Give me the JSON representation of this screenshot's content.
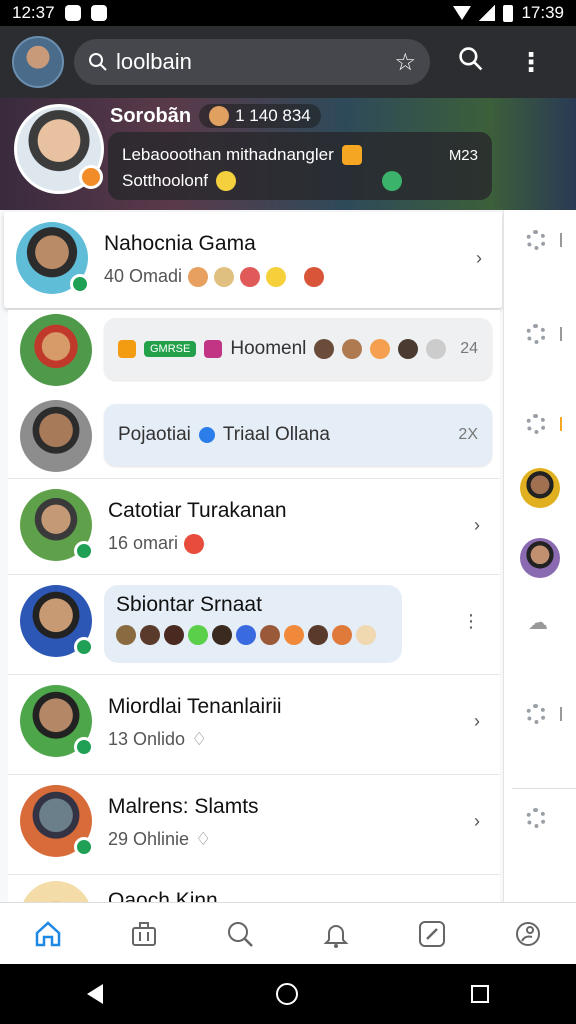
{
  "status_bar": {
    "time_left": "12:37",
    "time_right": "17:39"
  },
  "search": {
    "value": "loolbain"
  },
  "banner": {
    "name": "Sorobãn",
    "pill_text": "1 140 834",
    "line1": "Lebaooothan mithadnangler",
    "line1_right": "M23",
    "line2": "Sotthoolonf"
  },
  "chats": [
    {
      "name": "Nahocnia Gama",
      "sub": "40 Omadi"
    },
    {
      "preview": "Hoomenl",
      "time": "24",
      "chip": "GMRSE"
    },
    {
      "preview": "Pojaotiai",
      "preview2": "Triaal Ollana",
      "time": "2X"
    },
    {
      "name": "Catotiar Turakanan",
      "sub": "16 omari"
    },
    {
      "name": "Sbiontar Srnaat"
    },
    {
      "name": "Miordlai Tenanlairii",
      "sub": "13 Onlido"
    },
    {
      "name": "Malrens: Slamts",
      "sub": "29 Ohlinie"
    },
    {
      "name": "Oaoch Kinn"
    }
  ],
  "colors": {
    "accent": "#1e88e5",
    "online": "#1fa055",
    "top_bar": "#2b2d31"
  },
  "bottom_nav": [
    "home-icon",
    "briefcase-icon",
    "search-icon",
    "bell-icon",
    "compass-icon",
    "profile-icon"
  ]
}
